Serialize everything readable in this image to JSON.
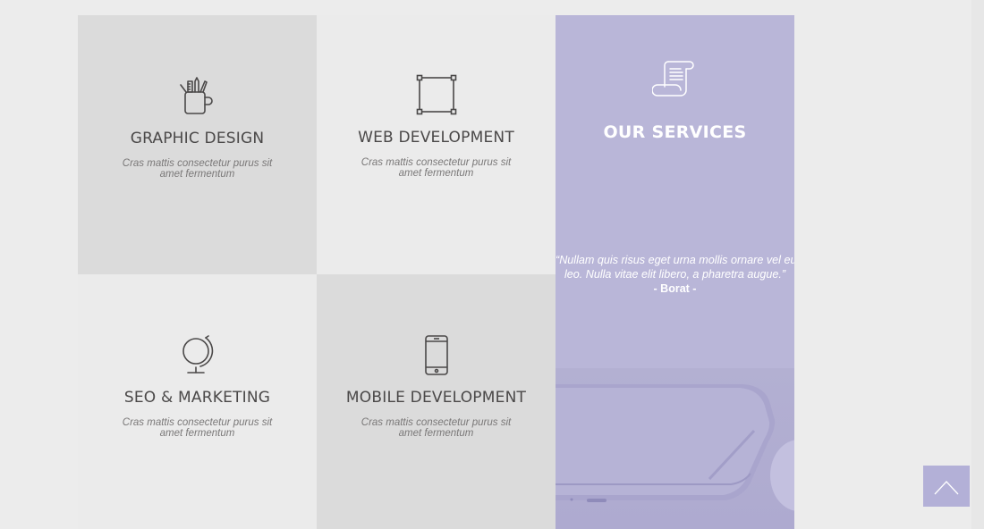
{
  "services_grid": {
    "tiles": [
      {
        "title": "GRAPHIC DESIGN",
        "description": "Cras mattis consectetur purus sit amet fermentum",
        "icon": "pencil-cup-icon"
      },
      {
        "title": "WEB DEVELOPMENT",
        "description": "Cras mattis consectetur purus sit amet fermentum",
        "icon": "vector-square-icon"
      },
      {
        "title": "SEO & MARKETING",
        "description": "Cras mattis consectetur purus sit amet fermentum",
        "icon": "globe-icon"
      },
      {
        "title": "MOBILE DEVELOPMENT",
        "description": "Cras mattis consectetur purus sit amet fermentum",
        "icon": "smartphone-icon"
      }
    ]
  },
  "services_panel": {
    "title": "OUR SERVICES",
    "icon": "scroll-document-icon",
    "quote_line_1": "“Nullam quis risus eget urna mollis ornare vel eu",
    "quote_line_2": "leo. Nulla vitae elit libero, a pharetra augue.”",
    "author": "- Borat -",
    "accent_color": "#b9b6d8"
  },
  "scroll_top": {
    "icon": "chevron-up-icon"
  }
}
